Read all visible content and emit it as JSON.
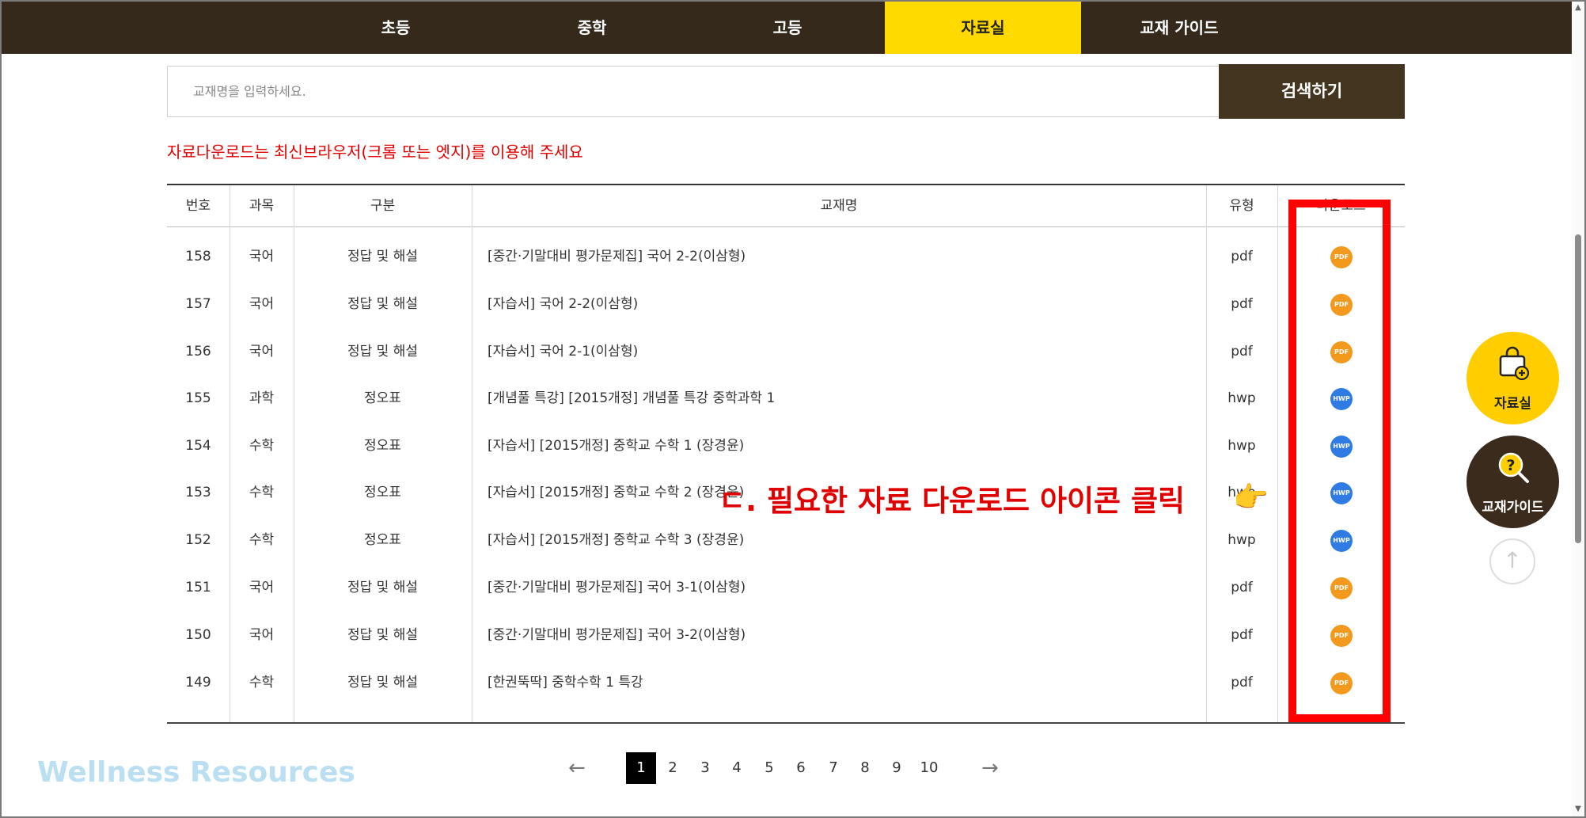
{
  "nav": {
    "items": [
      {
        "label": "초등"
      },
      {
        "label": "중학"
      },
      {
        "label": "고등"
      },
      {
        "label": "자료실"
      },
      {
        "label": "교재 가이드"
      }
    ],
    "active": "자료실"
  },
  "search": {
    "placeholder": "교재명을 입력하세요.",
    "button_label": "검색하기"
  },
  "notice": "자료다운로드는 최신브라우저(크롬 또는 엣지)를 이용해 주세요",
  "table": {
    "headers": [
      "번호",
      "과목",
      "구분",
      "교재명",
      "유형",
      "다운로드"
    ],
    "rows": [
      {
        "no": "158",
        "subject": "국어",
        "category": "정답 및 해설",
        "title": "[중간·기말대비 평가문제집] 국어 2-2(이삼형)",
        "type": "pdf",
        "icon": "PDF"
      },
      {
        "no": "157",
        "subject": "국어",
        "category": "정답 및 해설",
        "title": "[자습서] 국어 2-2(이삼형)",
        "type": "pdf",
        "icon": "PDF"
      },
      {
        "no": "156",
        "subject": "국어",
        "category": "정답 및 해설",
        "title": "[자습서] 국어 2-1(이삼형)",
        "type": "pdf",
        "icon": "PDF"
      },
      {
        "no": "155",
        "subject": "과학",
        "category": "정오표",
        "title": "[개념풀 특강] [2015개정] 개념풀 특강 중학과학 1",
        "type": "hwp",
        "icon": "HWP"
      },
      {
        "no": "154",
        "subject": "수학",
        "category": "정오표",
        "title": "[자습서] [2015개정] 중학교 수학 1 (장경윤)",
        "type": "hwp",
        "icon": "HWP"
      },
      {
        "no": "153",
        "subject": "수학",
        "category": "정오표",
        "title": "[자습서] [2015개정] 중학교 수학 2 (장경윤)",
        "type": "hwp",
        "icon": "HWP"
      },
      {
        "no": "152",
        "subject": "수학",
        "category": "정오표",
        "title": "[자습서] [2015개정] 중학교 수학 3 (장경윤)",
        "type": "hwp",
        "icon": "HWP"
      },
      {
        "no": "151",
        "subject": "국어",
        "category": "정답 및 해설",
        "title": "[중간·기말대비 평가문제집] 국어 3-1(이삼형)",
        "type": "pdf",
        "icon": "PDF"
      },
      {
        "no": "150",
        "subject": "국어",
        "category": "정답 및 해설",
        "title": "[중간·기말대비 평가문제집] 국어 3-2(이삼형)",
        "type": "pdf",
        "icon": "PDF"
      },
      {
        "no": "149",
        "subject": "수학",
        "category": "정답 및 해설",
        "title": "[한권뚝딱] 중학수학 1 특강",
        "type": "pdf",
        "icon": "PDF"
      }
    ]
  },
  "annotation": {
    "callout": "ㄷ. 필요한 자료 다운로드 아이콘 클릭",
    "hand_icon": "👉",
    "highlight_color": "#ff0000"
  },
  "floating": {
    "library_label": "자료실",
    "guide_label": "교재가이드",
    "top_icon": "↑"
  },
  "pagination": {
    "prev": "←",
    "next": "→",
    "pages": [
      "1",
      "2",
      "3",
      "4",
      "5",
      "6",
      "7",
      "8",
      "9",
      "10"
    ],
    "current": "1"
  },
  "watermark": "Wellness Resources",
  "colors": {
    "nav_bg": "#35291c",
    "nav_active": "#ffd900",
    "search_btn": "#443520",
    "notice": "#e00000",
    "pdf_icon": "#f39a1e",
    "hwp_icon": "#2f7be4"
  }
}
